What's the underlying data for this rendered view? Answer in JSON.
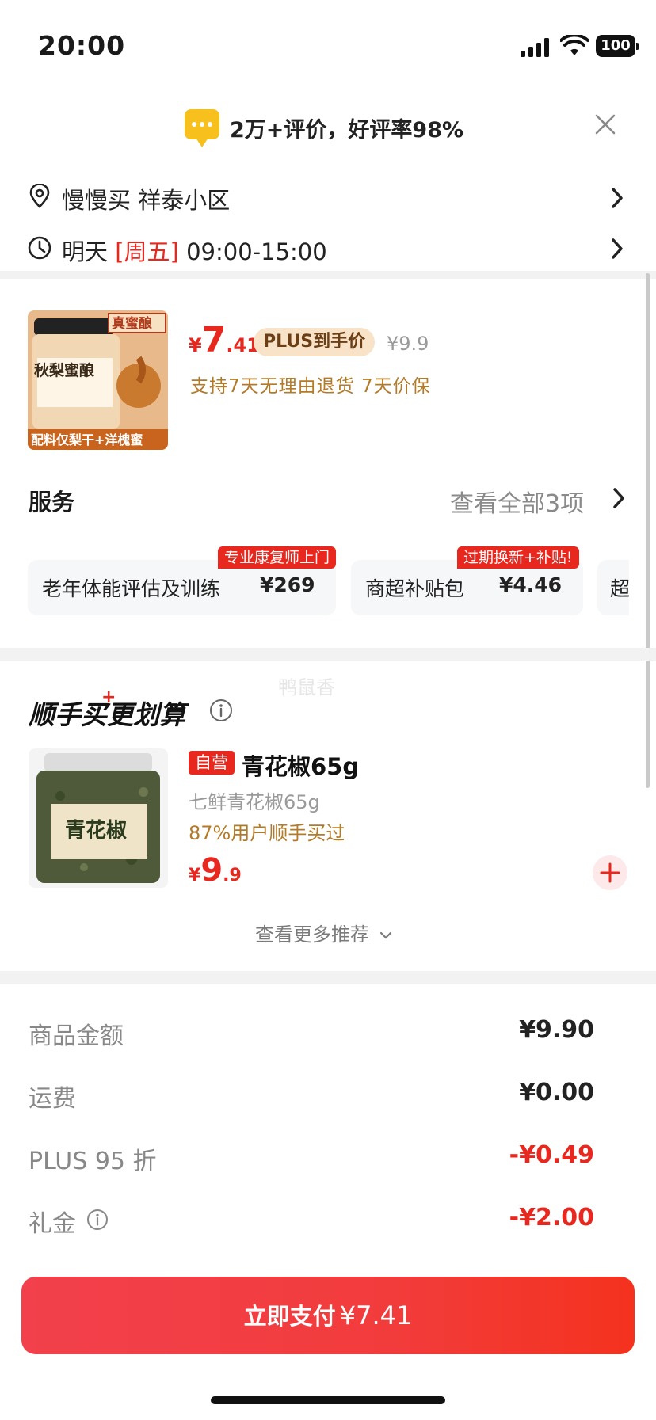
{
  "status_bar": {
    "time": "20:00",
    "battery": "100"
  },
  "review_banner": {
    "text": "2万+评价，好评率98%"
  },
  "address": {
    "text": "慢慢买  祥泰小区"
  },
  "delivery": {
    "day": "明天",
    "weekday": "[周五]",
    "window": "09:00-15:00"
  },
  "product": {
    "image_caption_top": "真蜜酿",
    "image_title": "秋梨蜜酿",
    "image_caption_bottom": "配料仅梨干+洋槐蜜",
    "price_symbol": "¥",
    "price_int": "7",
    "price_dec": ".41",
    "plus_tag": "PLUS到手价",
    "original_price": "¥9.9",
    "support": "支持7天无理由退货   7天价保"
  },
  "services": {
    "title": "服务",
    "more": "查看全部3项",
    "items": [
      {
        "badge": "专业康复师上门",
        "name": "老年体能评估及训练",
        "price": "¥269"
      },
      {
        "badge": "过期换新+补贴!",
        "name": "商超补贴包",
        "price": "¥4.46"
      },
      {
        "name": "超"
      }
    ]
  },
  "watermark": "鸭鼠香",
  "bundle": {
    "title": "顺手买更划算",
    "item": {
      "self_tag": "自营",
      "name": "青花椒65g",
      "sub": "七鲜青花椒65g",
      "bought": "87%用户顺手买过",
      "price_symbol": "¥",
      "price_int": "9",
      "price_dec": ".9",
      "image_label": "青花椒"
    },
    "more": "查看更多推荐"
  },
  "summary": [
    {
      "label": "商品金额",
      "value": "¥9.90",
      "red": false
    },
    {
      "label": "运费",
      "value": "¥0.00",
      "red": false
    },
    {
      "label": "PLUS 95 折",
      "value": "-¥0.49",
      "red": true
    },
    {
      "label": "礼金",
      "value": "-¥2.00",
      "red": true
    }
  ],
  "pay": {
    "label": "立即支付",
    "amount": "¥7.41"
  },
  "colors": {
    "accent": "#e8281e",
    "gold": "#b37a28",
    "plus_bg": "#f8e2c8"
  }
}
